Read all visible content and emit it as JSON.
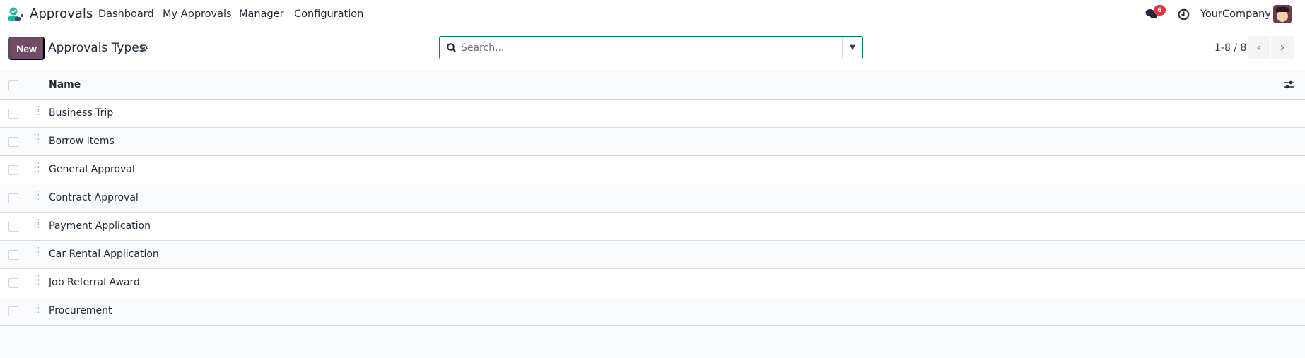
{
  "nav": {
    "app_name": "Approvals",
    "menu": [
      "Dashboard",
      "My Approvals",
      "Manager",
      "Configuration"
    ],
    "messages_count": "6",
    "company": "YourCompany"
  },
  "control": {
    "new_label": "New",
    "title": "Approvals Types",
    "search_placeholder": "Search...",
    "pager": "1-8 / 8"
  },
  "list": {
    "column": "Name",
    "rows": [
      "Business Trip",
      "Borrow Items",
      "General Approval",
      "Contract Approval",
      "Payment Application",
      "Car Rental Application",
      "Job Referral Award",
      "Procurement"
    ]
  },
  "colors": {
    "brand": "#714b67",
    "accent": "#017e84",
    "badge": "#dc3545"
  }
}
